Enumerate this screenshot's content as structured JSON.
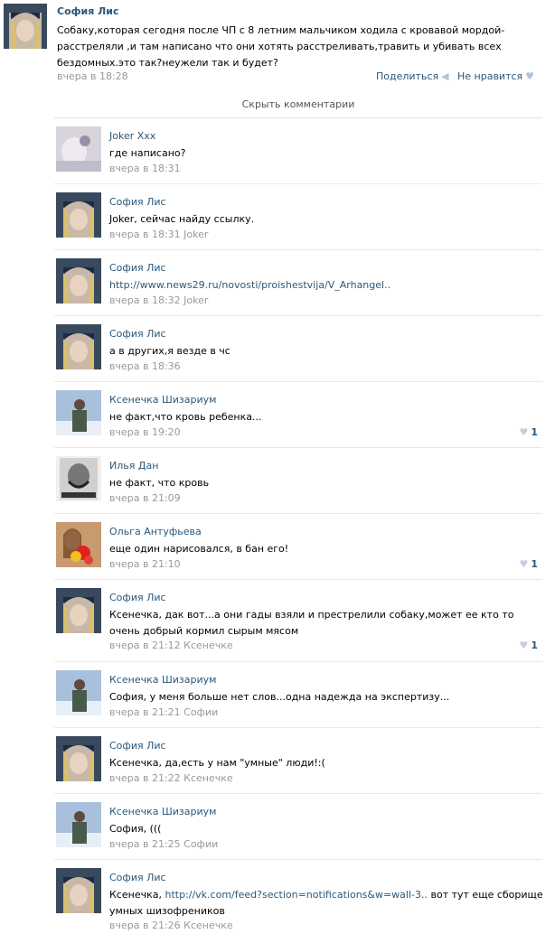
{
  "post": {
    "author": "София Лис",
    "text": "Собаку,которая сегодня после ЧП с 8 летним мальчиком ходила с кровавой мордой- расстреляли ,и там написано что они хотять расстреливать,травить и убивать всех бездомных.это так?неужели так и будет?",
    "time": "вчера в 18:28",
    "share_label": "Поделиться",
    "dislike_label": "Не нравится"
  },
  "hide_comments_label": "Скрыть комментарии",
  "comments": [
    {
      "author": "Joker Xxx",
      "text": "где написано?",
      "meta": "вчера в 18:31",
      "likes": ""
    },
    {
      "author": "София Лис",
      "text": "Joker, сейчас найду ссылку.",
      "meta": "вчера в 18:31 Joker",
      "likes": ""
    },
    {
      "author": "София Лис",
      "text": "",
      "link": "http://www.news29.ru/novosti/proishestvija/V_Arhangel..",
      "meta": "вчера в 18:32 Joker",
      "likes": ""
    },
    {
      "author": "София Лис",
      "text": "а в других,я везде в чс",
      "meta": "вчера в 18:36",
      "likes": ""
    },
    {
      "author": "Ксенечка Шизариум",
      "text": "не факт,что кровь ребенка...",
      "meta": "вчера в 19:20",
      "likes": "1"
    },
    {
      "author": "Илья Дан",
      "text": "не факт, что кровь",
      "meta": "вчера в 21:09",
      "likes": ""
    },
    {
      "author": "Ольга Антуфьева",
      "text": "еще один нарисовался, в бан его!",
      "meta": "вчера в 21:10",
      "likes": "1"
    },
    {
      "author": "София Лис",
      "text": "Ксенечка, дак вот...а они гады взяли и престрелили собаку,может ее кто то очень добрый кормил сырым мясом",
      "meta": "вчера в 21:12 Ксенечке",
      "likes": "1"
    },
    {
      "author": "Ксенечка Шизариум",
      "text": "София, у меня больше нет слов...одна надежда на экспертизу...",
      "meta": "вчера в 21:21 Софии",
      "likes": ""
    },
    {
      "author": "София Лис",
      "text": "Ксенечка, да,есть у нам \"умные\" люди!:(",
      "meta": "вчера в 21:22 Ксенечке",
      "likes": ""
    },
    {
      "author": "Ксенечка Шизариум",
      "text": "София, (((",
      "meta": "вчера в 21:25 Софии",
      "likes": ""
    },
    {
      "author": "София Лис",
      "text_prefix": "Ксенечка, ",
      "link": "http://vk.com/feed?section=notifications&w=wall-3..",
      "text_suffix": " вот тут еще сборище умных шизофреников",
      "meta": "вчера в 21:26 Ксенечке",
      "likes": ""
    }
  ],
  "colors": {
    "link": "#2b587a",
    "meta": "#999999",
    "divider": "#e6eaef",
    "like_heart": "#c3cfdc"
  },
  "icons": {
    "share": "megaphone-icon",
    "dislike": "heart-icon",
    "like": "heart-icon"
  }
}
